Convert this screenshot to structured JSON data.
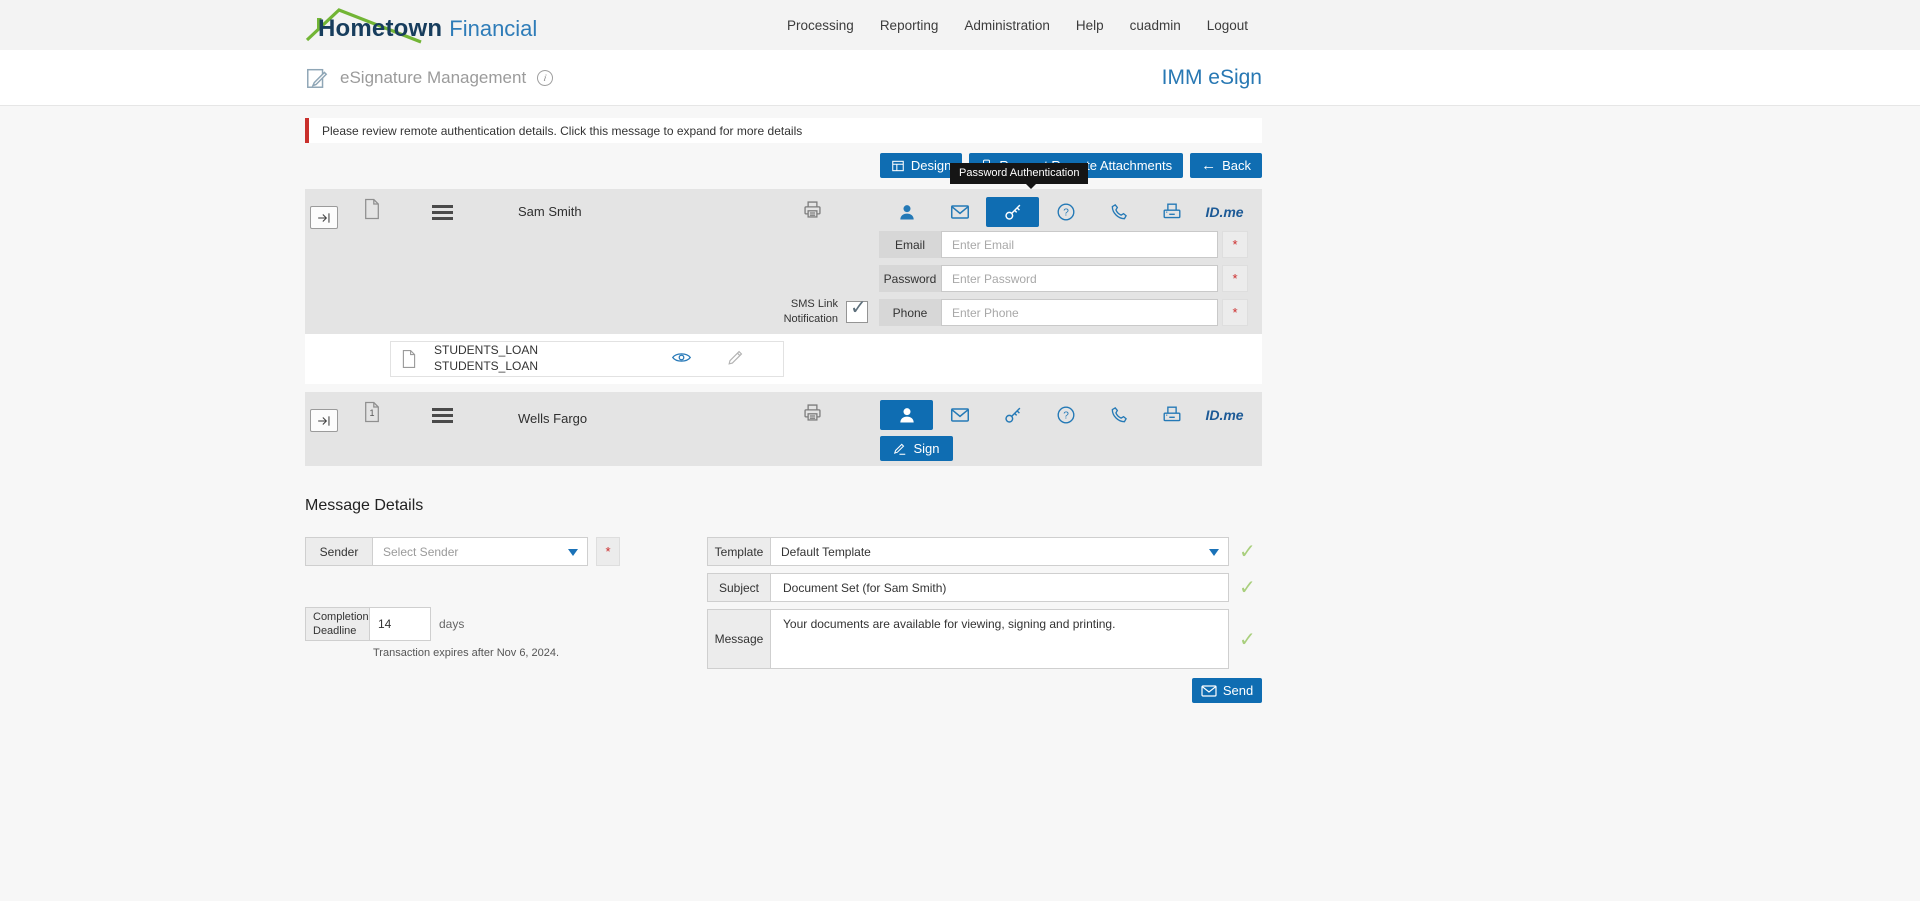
{
  "brand": {
    "bold": "Hometown",
    "light": "Financial"
  },
  "nav": {
    "processing": "Processing",
    "reporting": "Reporting",
    "administration": "Administration",
    "help": "Help",
    "user": "cuadmin",
    "logout": "Logout"
  },
  "header": {
    "title": "eSignature Management",
    "product": "IMM eSign"
  },
  "notice": "Please review remote authentication details. Click this message to expand for more details",
  "toolbar": {
    "design": "Design",
    "request_remote_attachments": "Request Remote Attachments",
    "back": "Back"
  },
  "tooltip": "Password Authentication",
  "idme": "ID.me",
  "signers": {
    "first": {
      "name": "Sam Smith",
      "fields": {
        "email_label": "Email",
        "email_placeholder": "Enter Email",
        "password_label": "Password",
        "password_placeholder": "Enter Password",
        "sms_label_line1": "SMS Link",
        "sms_label_line2": "Notification",
        "phone_label": "Phone",
        "phone_placeholder": "Enter Phone"
      },
      "documents": [
        "STUDENTS_LOAN",
        "STUDENTS_LOAN"
      ]
    },
    "second": {
      "name": "Wells Fargo",
      "doc_count": "1",
      "sign_label": "Sign"
    }
  },
  "message_details": {
    "heading": "Message Details",
    "sender_label": "Sender",
    "sender_value": "Select Sender",
    "deadline_label_line1": "Completion",
    "deadline_label_line2": "Deadline",
    "deadline_value": "14",
    "deadline_unit": "days",
    "expires_note": "Transaction expires after Nov 6, 2024.",
    "template_label": "Template",
    "template_value": "Default Template",
    "subject_label": "Subject",
    "subject_value": "Document Set (for Sam Smith)",
    "message_label": "Message",
    "message_value": "Your documents are available for viewing, signing and printing.",
    "send_label": "Send"
  },
  "icons": {
    "info": "i",
    "back_arrow": "←",
    "check": "✓",
    "asterisk": "*"
  },
  "colors": {
    "accent_blue": "#0f6db2",
    "brand_navy": "#173d5d",
    "brand_blue": "#2e7cb8",
    "logo_green": "#72b535",
    "alert_red": "#c9302c",
    "success_green": "#a9cf7d",
    "card_gray": "#e4e4e4"
  }
}
